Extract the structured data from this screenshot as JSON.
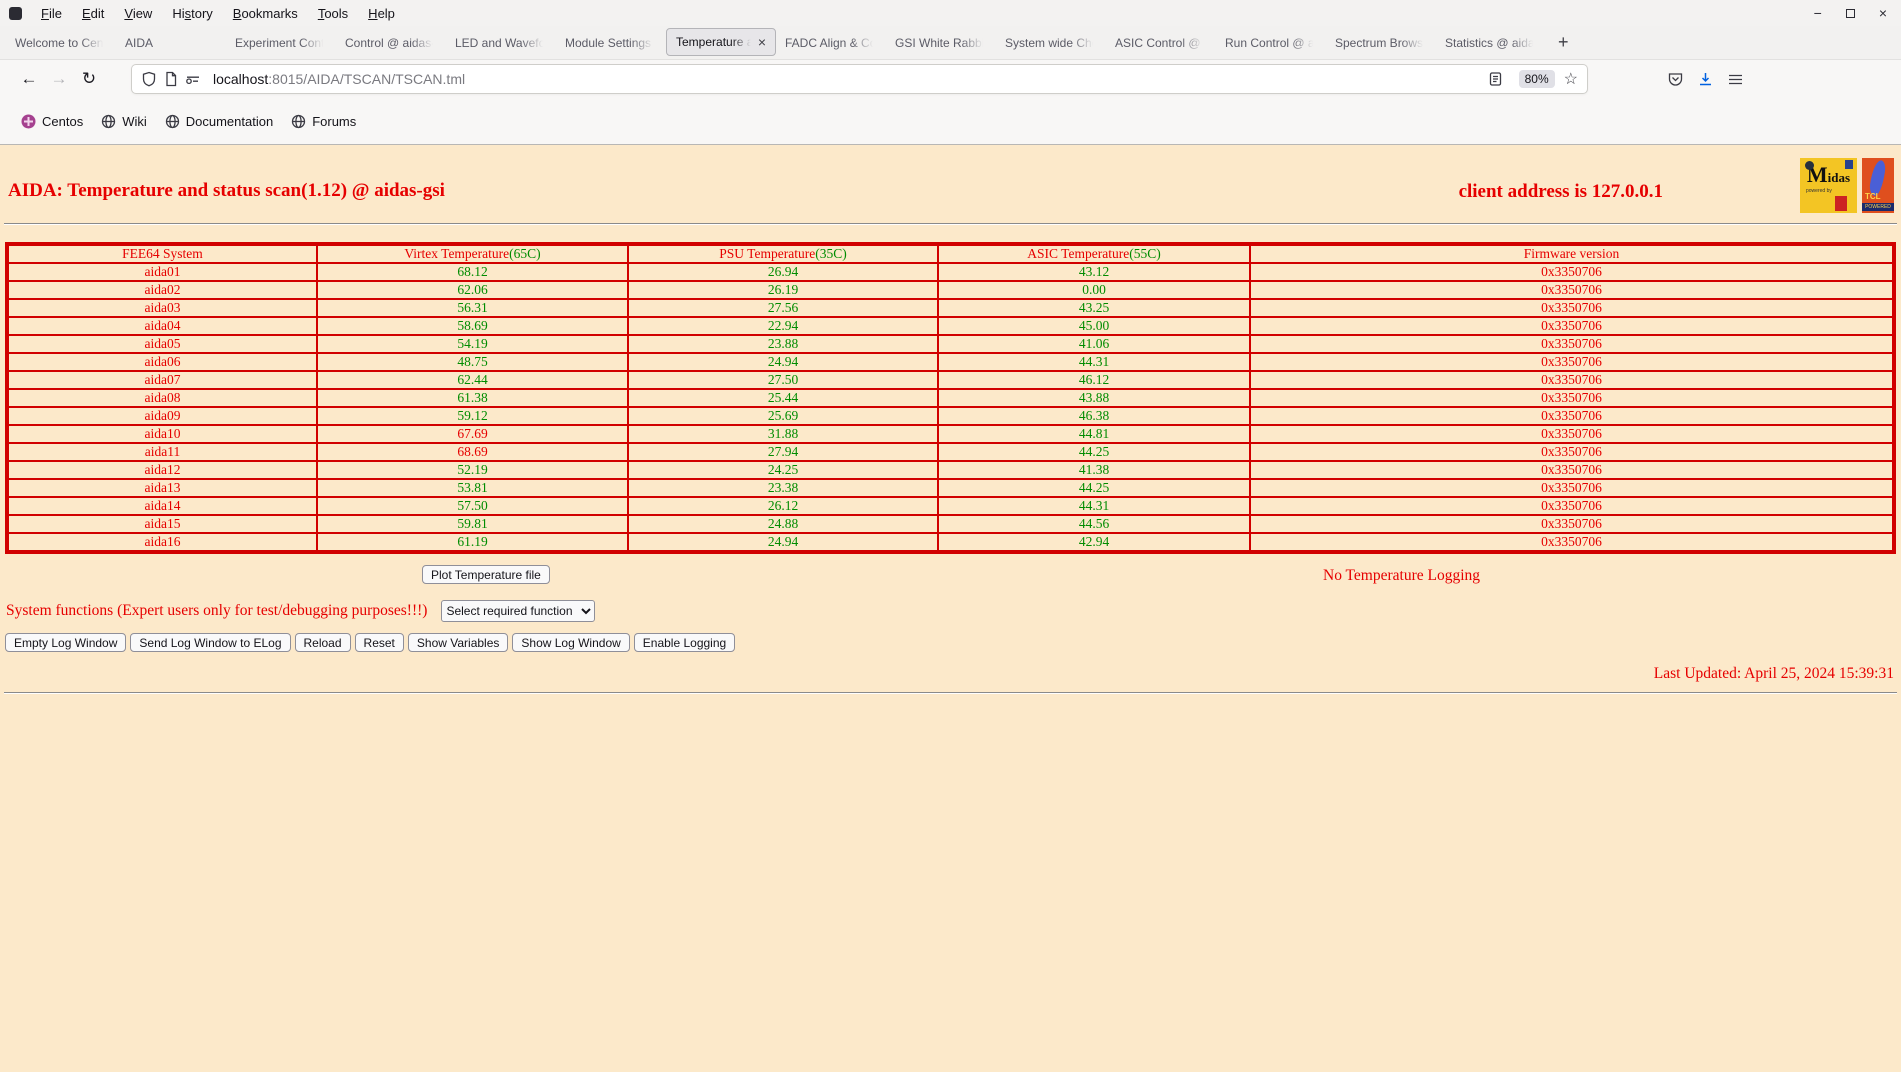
{
  "browser": {
    "menu_items": [
      {
        "label": "File",
        "m": 0
      },
      {
        "label": "Edit",
        "m": 0
      },
      {
        "label": "View",
        "m": 0
      },
      {
        "label": "History",
        "m": 2
      },
      {
        "label": "Bookmarks",
        "m": 0
      },
      {
        "label": "Tools",
        "m": 0
      },
      {
        "label": "Help",
        "m": 0
      }
    ],
    "tabs": [
      {
        "label": "Welcome to Cent"
      },
      {
        "label": "AIDA"
      },
      {
        "label": "Experiment Contr"
      },
      {
        "label": "Control @ aidas-"
      },
      {
        "label": "LED and Wavefor"
      },
      {
        "label": "Module Settings"
      },
      {
        "label": "Temperature a",
        "active": true
      },
      {
        "label": "FADC Align & Co"
      },
      {
        "label": "GSI White Rabbit"
      },
      {
        "label": "System wide Che"
      },
      {
        "label": "ASIC Control @ a"
      },
      {
        "label": "Run Control @ ai"
      },
      {
        "label": "Spectrum Brows"
      },
      {
        "label": "Statistics @ aida"
      }
    ],
    "icons": {
      "tab_close": "×",
      "new_tab": "+",
      "back": "←",
      "forward": "→",
      "reload": "↻",
      "star": "☆",
      "minimize": "−",
      "close_window": "×"
    },
    "nav": {
      "url_host": "localhost",
      "url_rest": ":8015/AIDA/TSCAN/TSCAN.tml",
      "zoom_level": "80%"
    },
    "bookmarks": [
      {
        "label": "Centos",
        "centos": true
      },
      {
        "label": "Wiki"
      },
      {
        "label": "Documentation"
      },
      {
        "label": "Forums"
      }
    ]
  },
  "page": {
    "title": "AIDA: Temperature and status scan(1.12) @ aidas-gsi",
    "client_address": "client address is 127.0.0.1",
    "logos": {
      "midas_text": "Midas",
      "midas_sub": "powered by",
      "tcl_text": "TCL",
      "tcl_sub": "POWERED"
    },
    "table": {
      "headers": [
        {
          "text": "FEE64 System",
          "suffix": ""
        },
        {
          "text": "Virtex Temperature",
          "suffix": "(65C)"
        },
        {
          "text": "PSU Temperature",
          "suffix": "(35C)"
        },
        {
          "text": "ASIC Temperature",
          "suffix": "(55C)"
        },
        {
          "text": "Firmware version",
          "suffix": ""
        }
      ],
      "rows": [
        {
          "name": "aida01",
          "virtex": "68.12",
          "psu": "26.94",
          "asic": "43.12",
          "fw": "0x3350706"
        },
        {
          "name": "aida02",
          "virtex": "62.06",
          "psu": "26.19",
          "asic": "0.00",
          "fw": "0x3350706"
        },
        {
          "name": "aida03",
          "virtex": "56.31",
          "psu": "27.56",
          "asic": "43.25",
          "fw": "0x3350706"
        },
        {
          "name": "aida04",
          "virtex": "58.69",
          "psu": "22.94",
          "asic": "45.00",
          "fw": "0x3350706"
        },
        {
          "name": "aida05",
          "virtex": "54.19",
          "psu": "23.88",
          "asic": "41.06",
          "fw": "0x3350706"
        },
        {
          "name": "aida06",
          "virtex": "48.75",
          "psu": "24.94",
          "asic": "44.31",
          "fw": "0x3350706"
        },
        {
          "name": "aida07",
          "virtex": "62.44",
          "psu": "27.50",
          "asic": "46.12",
          "fw": "0x3350706"
        },
        {
          "name": "aida08",
          "virtex": "61.38",
          "psu": "25.44",
          "asic": "43.88",
          "fw": "0x3350706"
        },
        {
          "name": "aida09",
          "virtex": "59.12",
          "psu": "25.69",
          "asic": "46.38",
          "fw": "0x3350706"
        },
        {
          "name": "aida10",
          "virtex": "67.69",
          "valert": true,
          "psu": "31.88",
          "asic": "44.81",
          "fw": "0x3350706"
        },
        {
          "name": "aida11",
          "virtex": "68.69",
          "valert": true,
          "psu": "27.94",
          "asic": "44.25",
          "fw": "0x3350706"
        },
        {
          "name": "aida12",
          "virtex": "52.19",
          "psu": "24.25",
          "asic": "41.38",
          "fw": "0x3350706"
        },
        {
          "name": "aida13",
          "virtex": "53.81",
          "psu": "23.38",
          "asic": "44.25",
          "fw": "0x3350706"
        },
        {
          "name": "aida14",
          "virtex": "57.50",
          "psu": "26.12",
          "asic": "44.31",
          "fw": "0x3350706"
        },
        {
          "name": "aida15",
          "virtex": "59.81",
          "psu": "24.88",
          "asic": "44.56",
          "fw": "0x3350706"
        },
        {
          "name": "aida16",
          "virtex": "61.19",
          "psu": "24.94",
          "asic": "42.94",
          "fw": "0x3350706"
        }
      ]
    },
    "plot_button": "Plot Temperature file",
    "no_logging": "No Temperature Logging",
    "system_functions_label": "System functions (Expert users only for test/debugging purposes!!!)",
    "select_value": "Select required function",
    "log_buttons": [
      "Empty Log Window",
      "Send Log Window to ELog",
      "Reload",
      "Reset",
      "Show Variables",
      "Show Log Window",
      "Enable Logging"
    ],
    "last_updated": "Last Updated: April 25, 2024 15:39:31"
  }
}
